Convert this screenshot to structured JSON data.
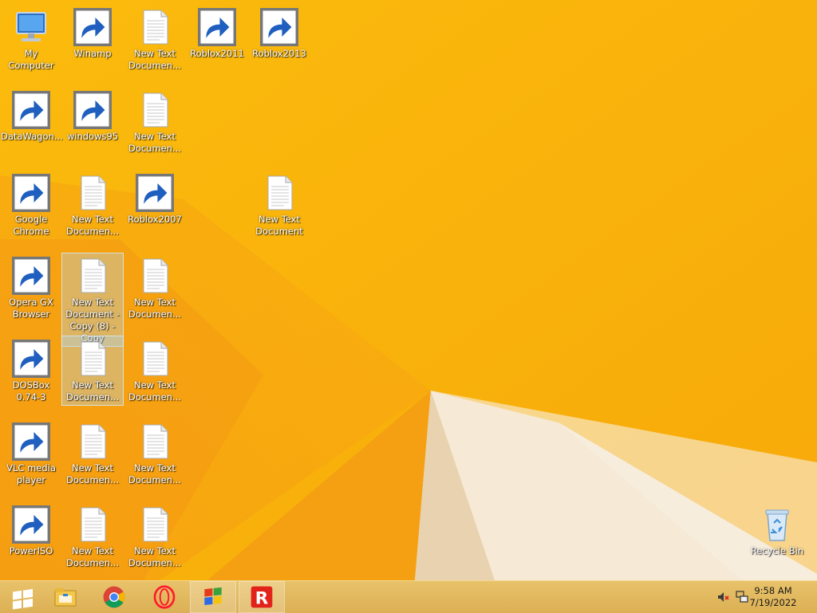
{
  "desktop": {
    "icons": [
      {
        "label": "My Computer",
        "icon": "computer-icon",
        "shortcut": false
      },
      {
        "label": "Winamp",
        "icon": "winamp-icon",
        "shortcut": true
      },
      {
        "label": "New Text Documen...",
        "icon": "text-document-icon",
        "shortcut": false
      },
      {
        "label": "Roblox2011",
        "icon": "roblox-icon",
        "shortcut": true
      },
      {
        "label": "Roblox2013",
        "icon": "roblox-icon",
        "shortcut": true
      },
      {
        "label": "DataWagon...",
        "icon": "datawagon-icon",
        "shortcut": true
      },
      {
        "label": "windows95",
        "icon": "windows95-icon",
        "shortcut": true
      },
      {
        "label": "New Text Documen...",
        "icon": "text-document-icon",
        "shortcut": false
      },
      {
        "label": "Google Chrome",
        "icon": "chrome-icon",
        "shortcut": true
      },
      {
        "label": "New Text Documen...",
        "icon": "text-document-icon",
        "shortcut": false
      },
      {
        "label": "Roblox2007",
        "icon": "roblox-icon",
        "shortcut": true
      },
      {
        "label": "New Text Document",
        "icon": "text-document-icon",
        "shortcut": false
      },
      {
        "label": "Opera GX Browser",
        "icon": "opera-gx-icon",
        "shortcut": true
      },
      {
        "label": "New Text Document - Copy (8) - Copy",
        "icon": "text-document-icon",
        "shortcut": false,
        "selected": true
      },
      {
        "label": "New Text Documen...",
        "icon": "text-document-icon",
        "shortcut": false
      },
      {
        "label": "DOSBox 0.74-3",
        "icon": "dosbox-icon",
        "shortcut": true
      },
      {
        "label": "New Text Documen...",
        "icon": "text-document-icon",
        "shortcut": false,
        "selected": true
      },
      {
        "label": "New Text Documen...",
        "icon": "text-document-icon",
        "shortcut": false
      },
      {
        "label": "VLC media player",
        "icon": "vlc-icon",
        "shortcut": true
      },
      {
        "label": "New Text Documen...",
        "icon": "text-document-icon",
        "shortcut": false
      },
      {
        "label": "New Text Documen...",
        "icon": "text-document-icon",
        "shortcut": false
      },
      {
        "label": "PowerISO",
        "icon": "poweriso-icon",
        "shortcut": true
      },
      {
        "label": "New Text Documen...",
        "icon": "text-document-icon",
        "shortcut": false
      },
      {
        "label": "New Text Documen...",
        "icon": "text-document-icon",
        "shortcut": false
      },
      {
        "label": "Recycle Bin",
        "icon": "recycle-bin-icon",
        "shortcut": false
      }
    ]
  },
  "taskbar": {
    "buttons": [
      {
        "icon": "windows-start-icon"
      },
      {
        "icon": "file-explorer-icon"
      },
      {
        "icon": "chrome-icon"
      },
      {
        "icon": "opera-gx-icon"
      },
      {
        "icon": "windows95-icon",
        "active": true
      },
      {
        "icon": "roblox-icon",
        "active": true
      }
    ],
    "tray": {
      "icons": [
        "volume-muted-icon",
        "network-icon"
      ],
      "time": "9:58 AM",
      "date": "7/19/2022"
    }
  },
  "colors": {
    "wallpaper": "#f8b50a",
    "wallpaper_dark": "#f39a12",
    "wallpaper_light": "#f9ecd8",
    "taskbar": "#e2b85e",
    "roblox_red": "#e2231a",
    "opera_red": "#ff1b2d"
  }
}
